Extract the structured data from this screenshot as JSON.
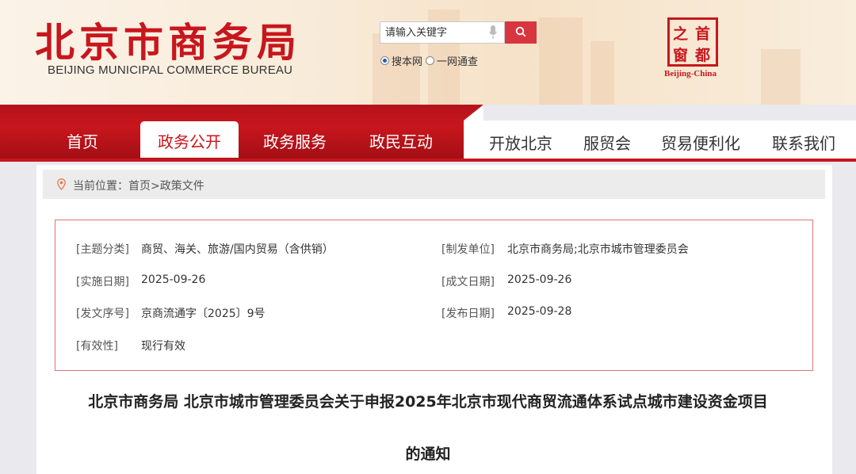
{
  "header": {
    "logo_cn": "北京市商务局",
    "logo_en": "BEIJING MUNICIPAL COMMERCE BUREAU",
    "search": {
      "placeholder": "请输入关键字"
    },
    "search_scopes": [
      "搜本网",
      "一网通查"
    ],
    "seal": {
      "chars": [
        "之",
        "首",
        "窗",
        "都"
      ],
      "caption": "Beijing-China"
    }
  },
  "nav": {
    "items": [
      "首页",
      "政务公开",
      "政务服务",
      "政民互动",
      "开放北京",
      "服贸会",
      "贸易便利化",
      "联系我们"
    ],
    "active": "政务公开"
  },
  "breadcrumb": {
    "label": "当前位置：",
    "path": "首页>政策文件"
  },
  "meta": {
    "left": [
      {
        "label": "[主题分类]",
        "value": "商贸、海关、旅游/国内贸易（含供销）"
      },
      {
        "label": "[实施日期]",
        "value": "2025-09-26"
      },
      {
        "label": "[发文序号]",
        "value": "京商流通字〔2025〕9号"
      },
      {
        "label": "[有效性]",
        "value": "现行有效"
      }
    ],
    "right": [
      {
        "label": "[制发单位]",
        "value": "北京市商务局;北京市城市管理委员会"
      },
      {
        "label": "[成文日期]",
        "value": "2025-09-26"
      },
      {
        "label": "[发布日期]",
        "value": "2025-09-28"
      }
    ]
  },
  "document": {
    "title_line1": "北京市商务局 北京市城市管理委员会关于申报2025年北京市现代商贸流通体系试点城市建设资金项目",
    "title_line2": "的通知"
  },
  "colors": {
    "brand_red": "#c8161d",
    "search_button": "#d8363e"
  }
}
